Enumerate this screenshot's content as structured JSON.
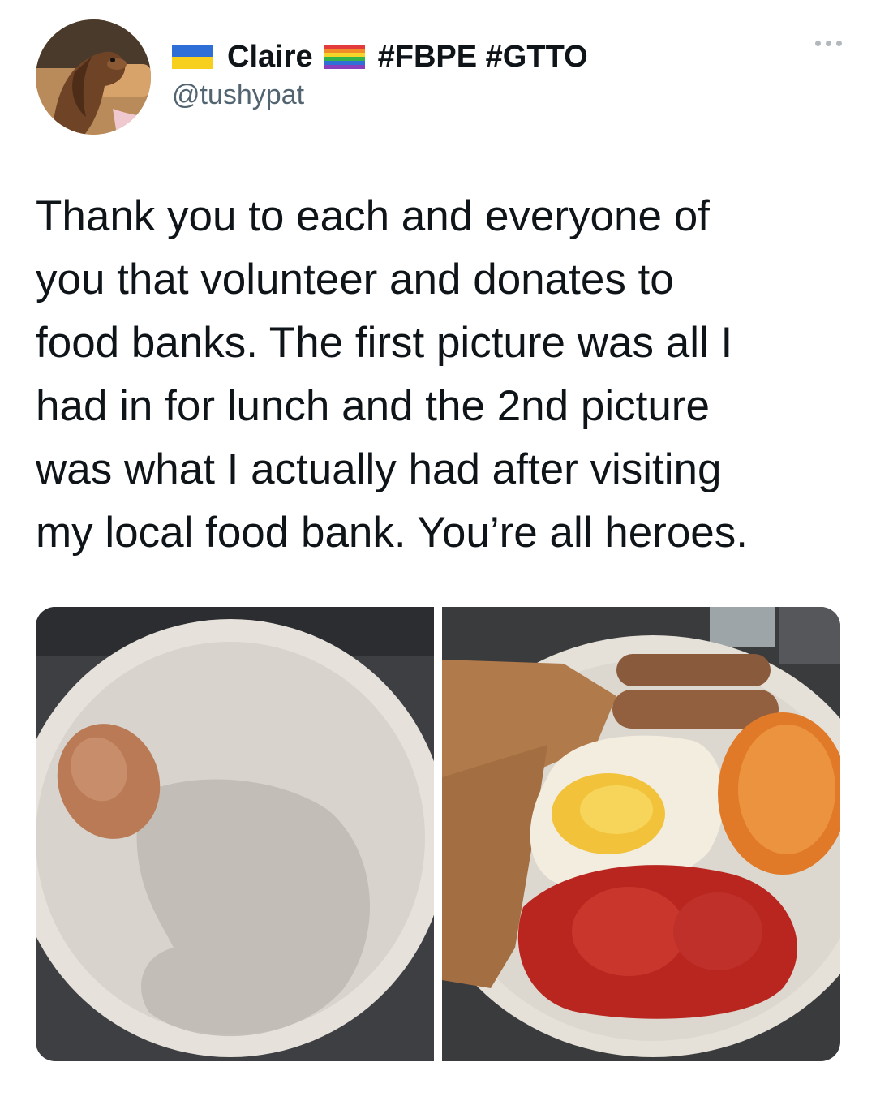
{
  "author": {
    "display_name": "Claire",
    "hashtags": "#FBPE #GTTO",
    "handle": "@tushypat",
    "avatar_icon": "dachshund-avatar",
    "flag_icons": [
      "ukraine-flag-icon",
      "rainbow-flag-icon"
    ]
  },
  "tweet": {
    "text": "Thank you to each and everyone of\nyou that volunteer and donates to\nfood banks. The first picture was all I\nhad in for lunch and the 2nd picture\nwas what I actually had after visiting\nmy local food bank. You’re all heroes."
  },
  "media": {
    "photo_count": 2,
    "icons": [
      "photo-egg-on-plate",
      "photo-full-breakfast"
    ]
  },
  "colors": {
    "text": "#0f1419",
    "secondary_text": "#536471",
    "ukraine_blue": "#2d6fd6",
    "ukraine_yellow": "#f7cf1d"
  }
}
